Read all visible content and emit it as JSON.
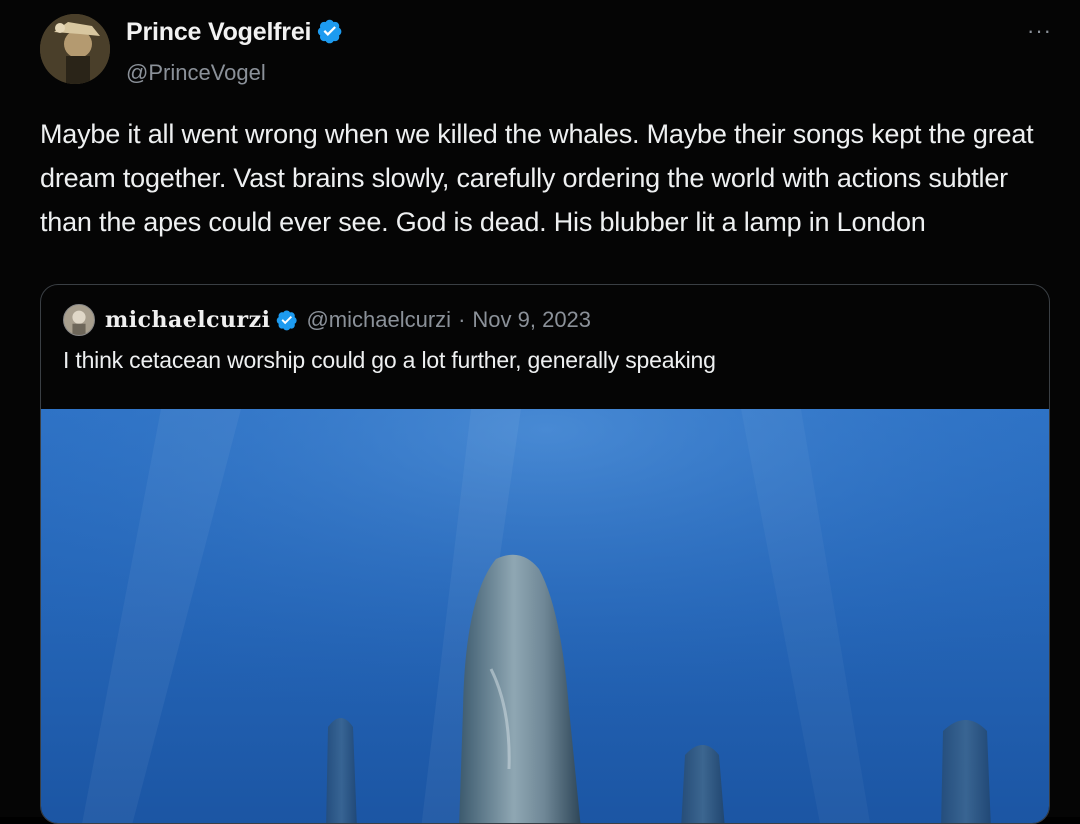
{
  "post": {
    "author_name": "Prince Vogelfrei",
    "author_handle": "@PrinceVogel",
    "more_label": "···",
    "text": "Maybe it all went wrong when we killed the whales. Maybe their songs kept the great dream together. Vast brains slowly, carefully ordering the world with actions subtler than the apes could ever see. God is dead. His blubber lit a lamp in London",
    "verified": true,
    "verified_icon": "verified-badge-icon",
    "avatar_icon": "profile-photo"
  },
  "quote": {
    "author_name": "michaelcurzi",
    "author_handle": "@michaelcurzi",
    "separator": "·",
    "date": "Nov 9, 2023",
    "text": "I think cetacean worship could go a lot further, generally speaking",
    "verified": true,
    "media": "photo of sperm whales sleeping vertically underwater"
  },
  "colors": {
    "background": "#050505",
    "text_primary": "#eef0f1",
    "text_secondary": "#8b9199",
    "verified_blue": "#1d9bf0",
    "card_border": "#3a3f44",
    "ocean": "#2a6fc0"
  }
}
